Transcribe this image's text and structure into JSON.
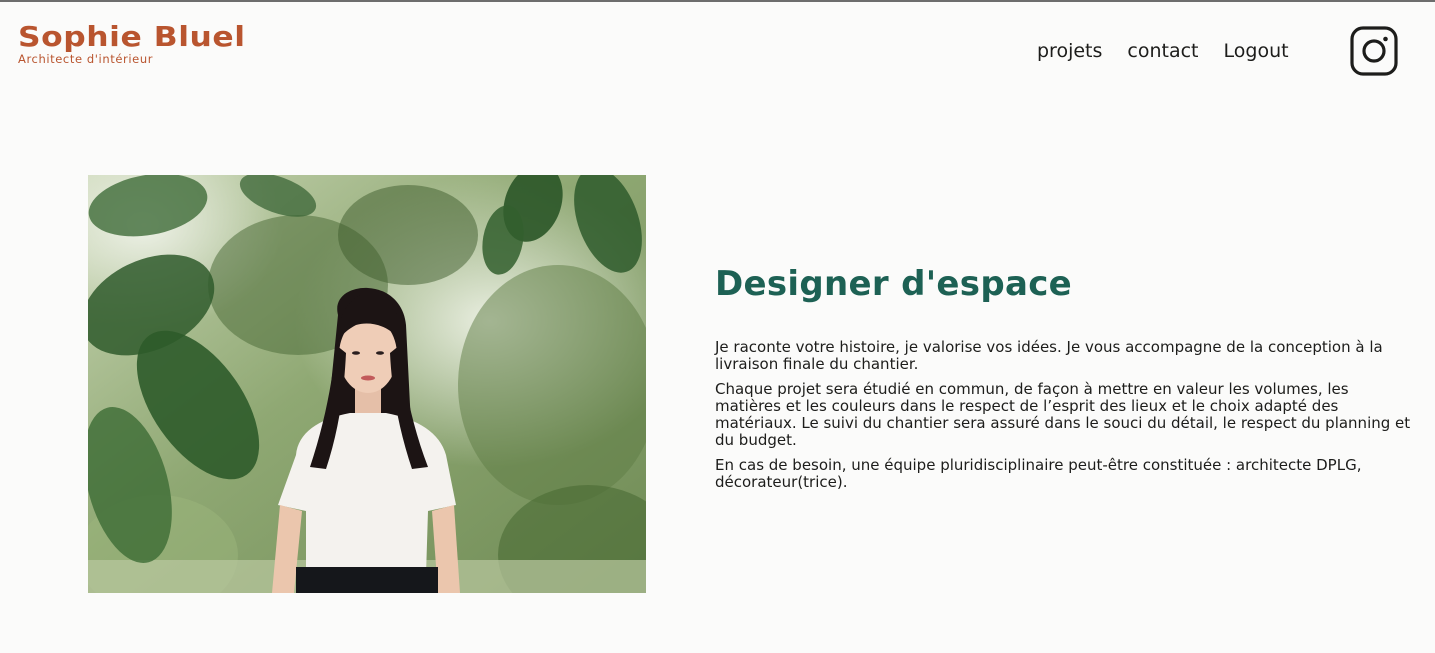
{
  "header": {
    "logo_title": "Sophie Bluel",
    "logo_subtitle": "Architecte d'intérieur",
    "nav": {
      "projects": "projets",
      "contact": "contact",
      "logout": "Logout"
    },
    "social_icon": "instagram-icon"
  },
  "introduction": {
    "photo": "portrait-photo",
    "title": "Designer d'espace",
    "paragraphs": [
      "Je raconte votre histoire, je valorise vos idées. Je vous accompagne de la conception à la livraison finale du chantier.",
      "Chaque projet sera étudié en commun, de façon à mettre en valeur les volumes, les matières et les couleurs dans le respect de l’esprit des lieux et le choix adapté des matériaux. Le suivi du chantier sera assuré dans le souci du détail, le respect du planning et du budget.",
      "En cas de besoin, une équipe pluridisciplinaire peut-être constituée : architecte DPLG, décorateur(trice)."
    ]
  },
  "colors": {
    "brand": "#b9552f",
    "title_green": "#1d6154",
    "text": "#1d1d1b",
    "background": "#fbfbfa"
  }
}
